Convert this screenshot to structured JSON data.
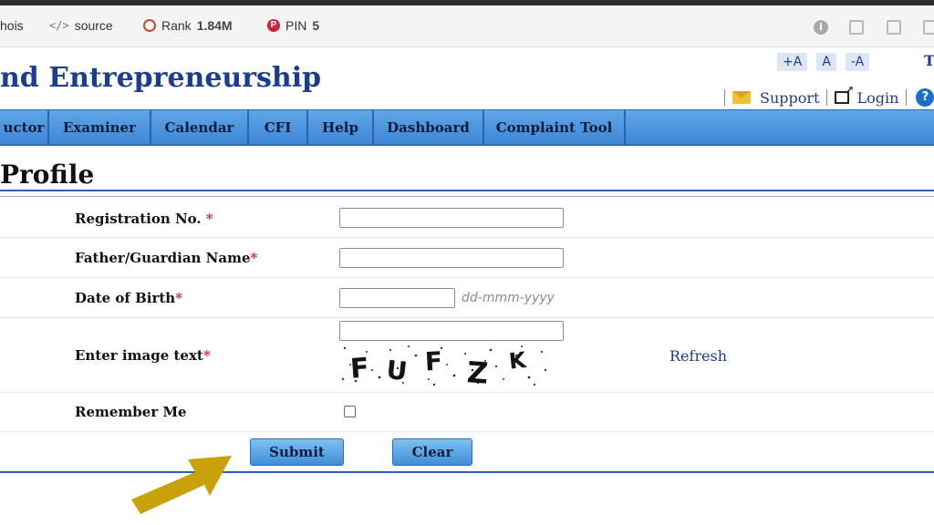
{
  "extension_bar": {
    "whois": "hois",
    "source": "source",
    "rank_label": "Rank",
    "rank_value": "1.84M",
    "pin_label": "PIN",
    "pin_value": "5"
  },
  "header": {
    "site_title": "nd Entrepreneurship",
    "font_increase": "+A",
    "font_normal": "A",
    "font_decrease": "-A",
    "cut_letter": "T",
    "support": "Support",
    "login": "Login",
    "help_mark": "?"
  },
  "nav": {
    "items": [
      "uctor",
      "Examiner",
      "Calendar",
      "CFI",
      "Help",
      "Dashboard",
      "Complaint Tool"
    ]
  },
  "page": {
    "title": "Profile"
  },
  "form": {
    "registration_label": "Registration No.",
    "registration_value": "",
    "guardian_label": "Father/Guardian Name",
    "guardian_value": "",
    "dob_label": "Date of Birth",
    "dob_value": "",
    "dob_hint": "dd-mmm-yyyy",
    "captcha_label": "Enter image text",
    "captcha_value": "",
    "captcha_text": "FUFZK",
    "refresh": "Refresh",
    "remember_label": "Remember Me",
    "remember_checked": false,
    "required_mark": "*",
    "submit": "Submit",
    "clear": "Clear"
  },
  "colors": {
    "brand": "#1b3d8f",
    "nav": "#4a93de",
    "required": "#d62a2a",
    "arrow": "#c9a10a"
  }
}
